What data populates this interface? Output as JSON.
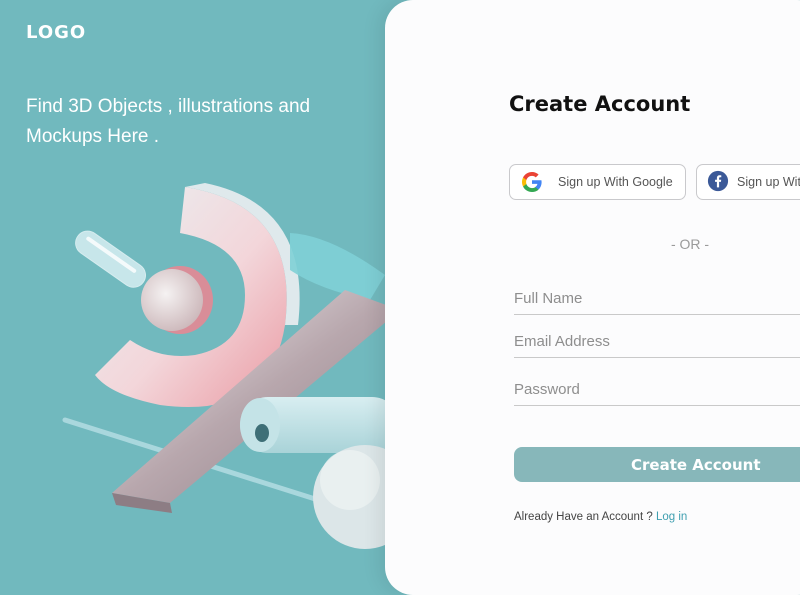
{
  "brand": {
    "logo": "LOGO",
    "tagline": "Find 3D Objects , illustrations and Mockups Here ."
  },
  "form": {
    "title": "Create Account",
    "google_label": "Sign up With Google",
    "facebook_label": "Sign up With Facebook",
    "divider": "- OR -",
    "full_name_placeholder": "Full Name",
    "email_placeholder": "Email Address",
    "password_placeholder": "Password",
    "submit_label": "Create Account",
    "already_text": "Already Have an Account ?",
    "login_link": "Log in"
  },
  "icons": {
    "google": "google-icon",
    "facebook": "facebook-icon"
  },
  "colors": {
    "background": "#71b9be",
    "card": "#fcfcfd",
    "button": "#87b7ba",
    "link": "#3f9fb0",
    "facebook": "#3b5998"
  }
}
